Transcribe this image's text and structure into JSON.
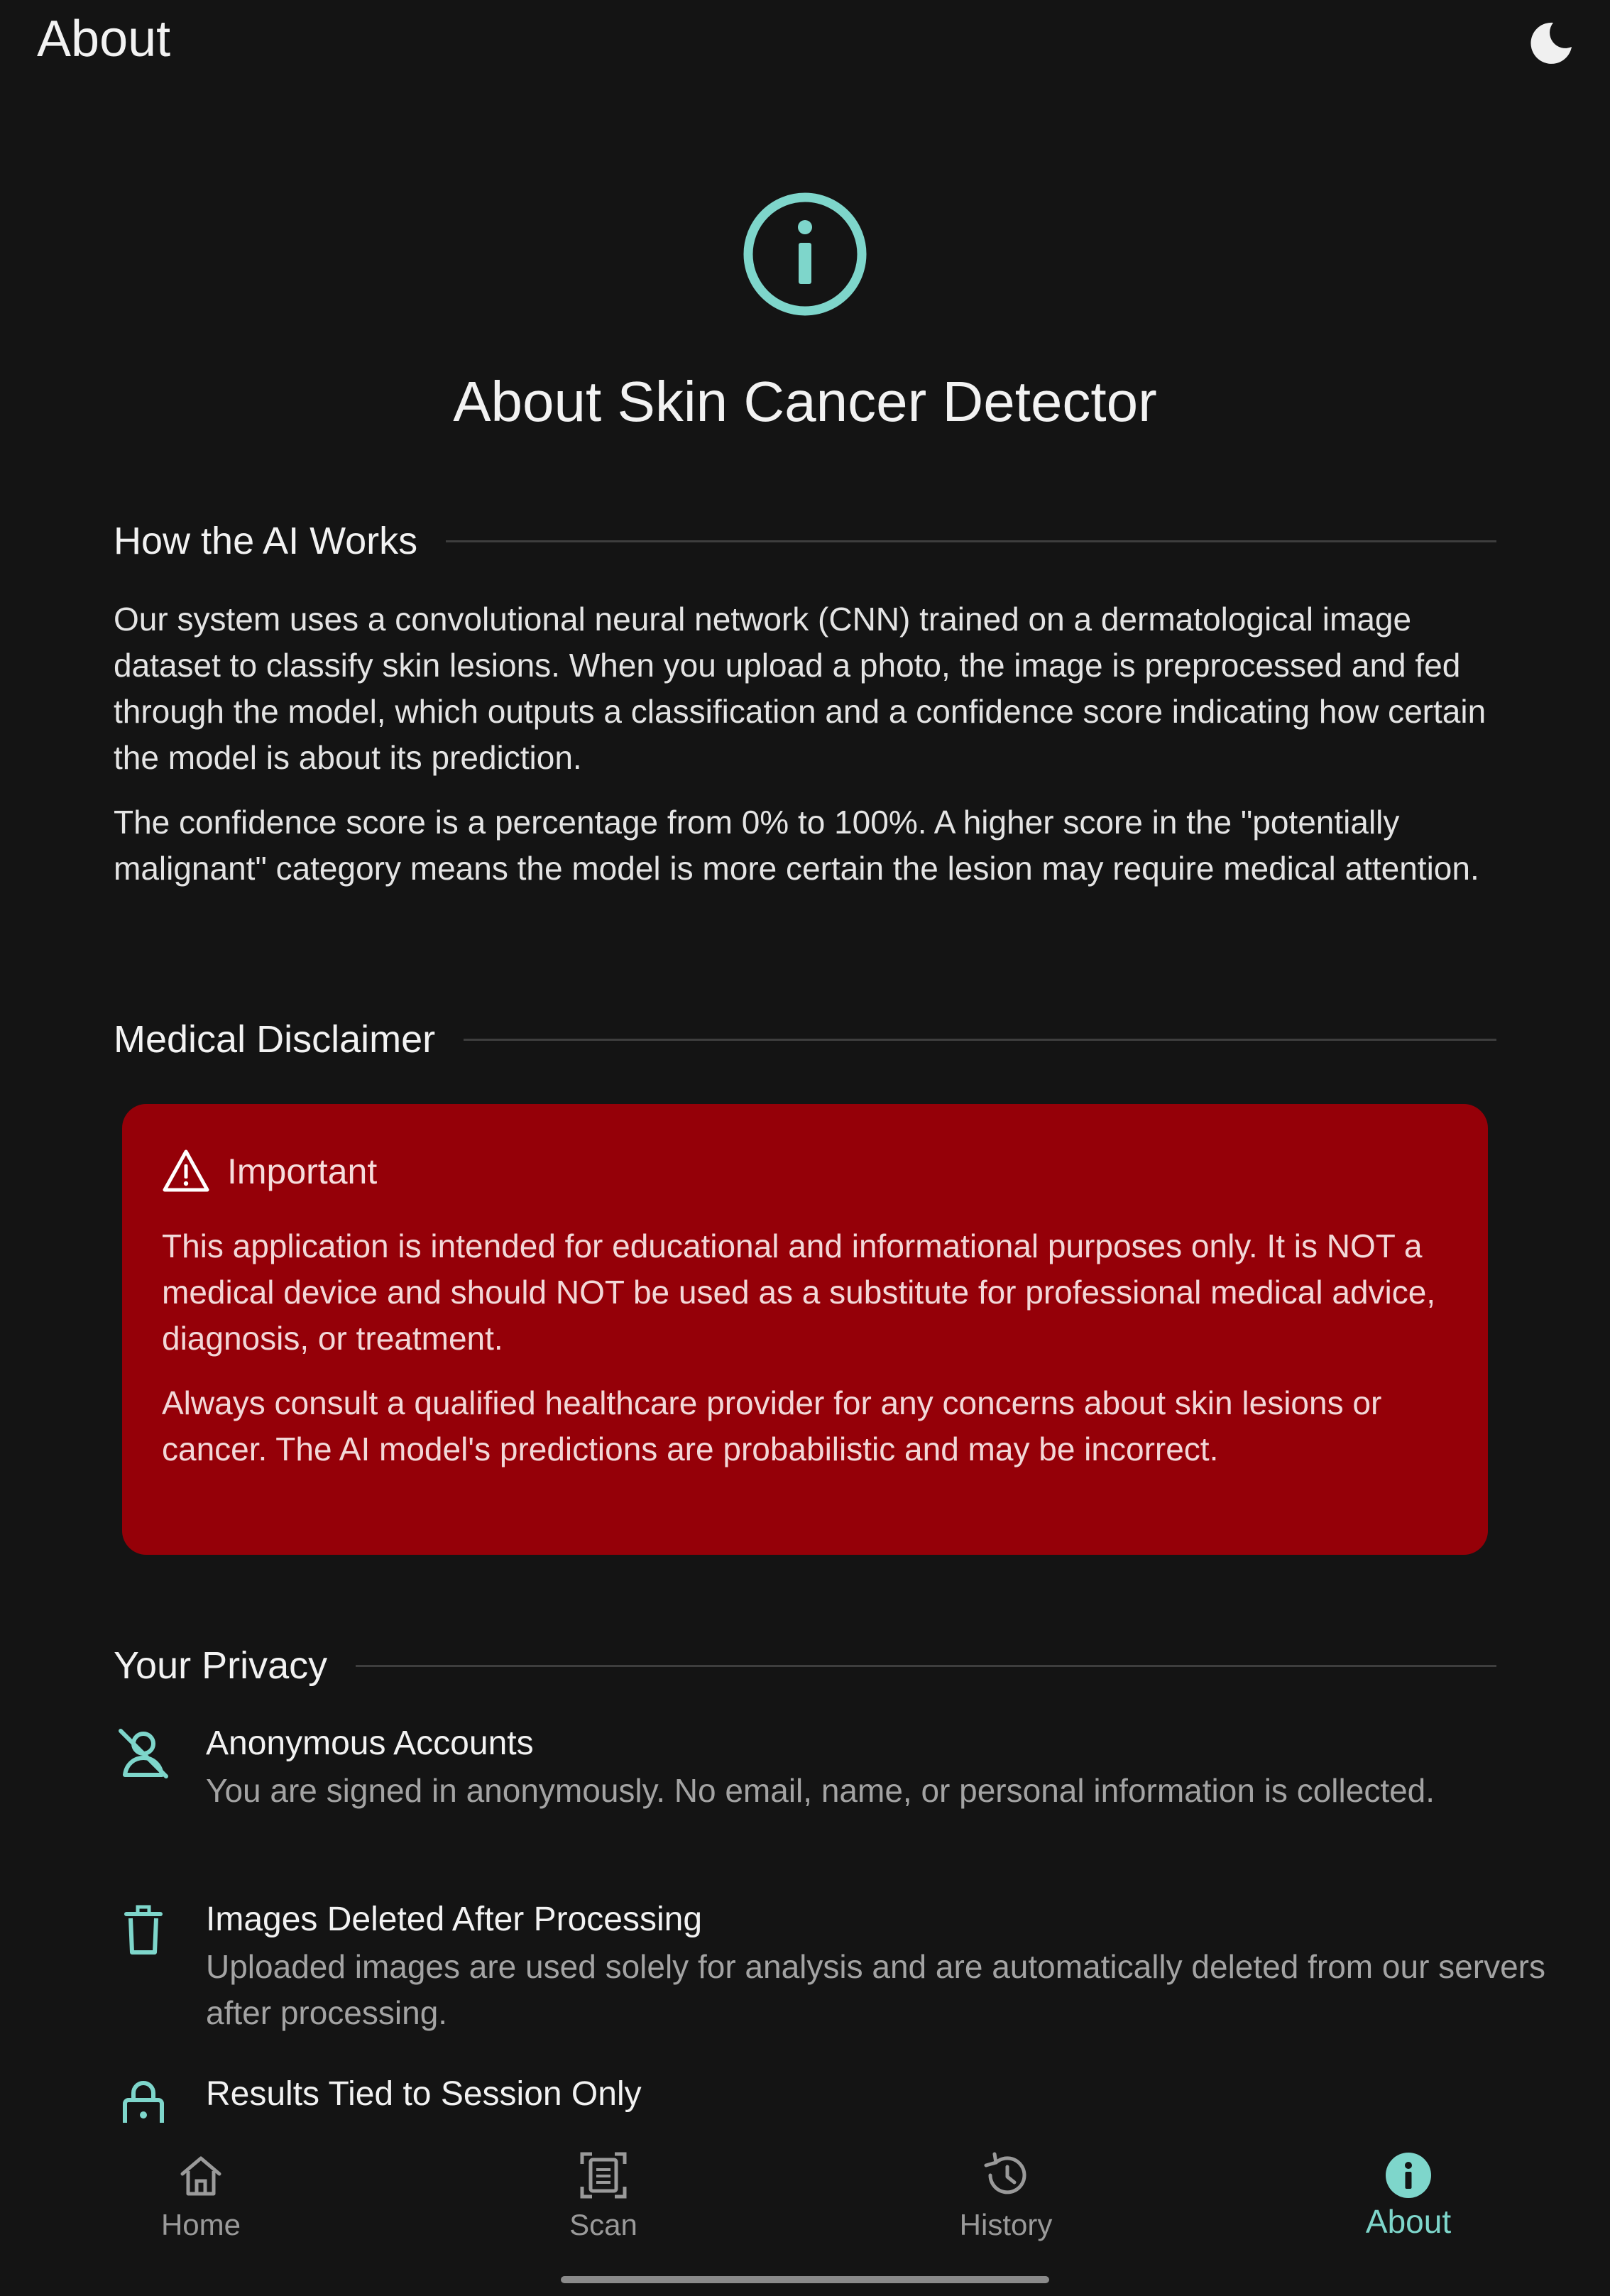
{
  "app_bar": {
    "title": "About",
    "theme_icon": "moon-icon"
  },
  "hero": {
    "icon": "info-circle-icon",
    "title": "About Skin Cancer Detector"
  },
  "how_ai_works": {
    "heading": "How the AI Works",
    "paragraphs": [
      "Our system uses a convolutional neural network (CNN) trained on a dermatological image dataset to classify skin lesions. When you upload a photo, the image is preprocessed and fed through the model, which outputs a classification and a confidence score indicating how certain the model is about its prediction.",
      "The confidence score is a percentage from 0% to 100%. A higher score in the \"potentially malignant\" category means the model is more certain the lesion may require medical attention."
    ]
  },
  "disclaimer": {
    "heading": "Medical Disclaimer",
    "card_title": "Important",
    "card_icon": "warning-triangle-icon",
    "paragraphs": [
      "This application is intended for educational and informational purposes only. It is NOT a medical device and should NOT be used as a substitute for professional medical advice, diagnosis, or treatment.",
      "Always consult a qualified healthcare provider for any concerns about skin lesions or cancer. The AI model's predictions are probabilistic and may be incorrect."
    ]
  },
  "privacy": {
    "heading": "Your Privacy",
    "items": [
      {
        "icon": "user-off-icon",
        "title": "Anonymous Accounts",
        "description": "You are signed in anonymously. No email, name, or personal information is collected."
      },
      {
        "icon": "trash-icon",
        "title": "Images Deleted After Processing",
        "description": "Uploaded images are used solely for analysis and are automatically deleted from our servers after processing."
      },
      {
        "icon": "lock-icon",
        "title": "Results Tied to Session Only",
        "description": ""
      }
    ]
  },
  "bottom_nav": {
    "active": "About",
    "items": [
      {
        "label": "Home",
        "icon": "home-icon"
      },
      {
        "label": "Scan",
        "icon": "scan-icon"
      },
      {
        "label": "History",
        "icon": "history-icon"
      },
      {
        "label": "About",
        "icon": "info-icon"
      }
    ]
  },
  "colors": {
    "background": "#141414",
    "accent": "#7ED6CB",
    "disclaimer_card": "#950008",
    "text_primary": "#F2F2F2",
    "text_secondary": "#A3A3A3"
  }
}
